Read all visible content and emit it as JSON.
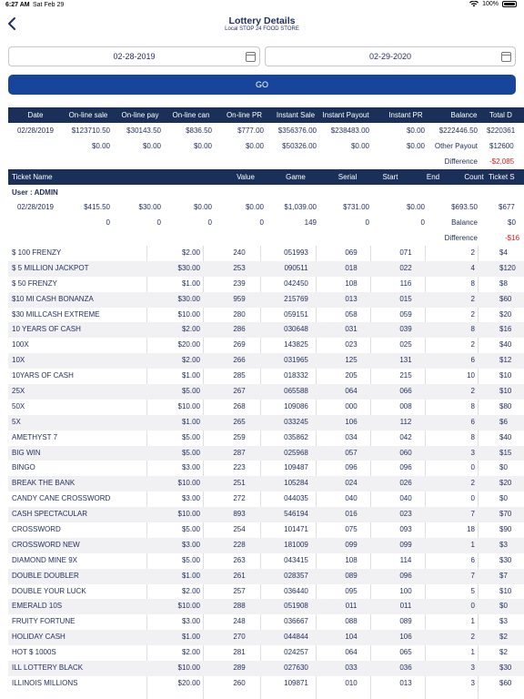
{
  "status": {
    "time": "6:27 AM",
    "date": "Sat Feb 29",
    "battery": "100%"
  },
  "nav": {
    "title": "Lottery Details",
    "subtitle": "Local STOP 24 FOOD STORE"
  },
  "filters": {
    "start_date": "02-28-2019",
    "end_date": "02-29-2020",
    "go_label": "GO"
  },
  "summary": {
    "headers": [
      "Date",
      "On-line sale",
      "On-line pay",
      "On-line can",
      "On-line PR",
      "Instant Sale",
      "Instant Payout",
      "Instant PR",
      "Balance",
      "Total D"
    ],
    "row1": [
      "02/28/2019",
      "$123710.50",
      "$30143.50",
      "$836.50",
      "$777.00",
      "$356376.00",
      "$238483.00",
      "$0.00",
      "$222446.50",
      "$220361"
    ],
    "row2": [
      "$0.00",
      "$0.00",
      "$0.00",
      "$0.00",
      "$50326.00",
      "$0.00",
      "$0.00",
      "Other Payout",
      "$12600"
    ],
    "row3": [
      "Difference",
      "-$2,085"
    ]
  },
  "ticket_section": {
    "headers": [
      "Ticket Name",
      "Value",
      "Game",
      "Serial",
      "Start",
      "End",
      "Count",
      "Ticket S"
    ],
    "user_label": "User : ADMIN",
    "user_row1": [
      "02/28/2019",
      "$415.50",
      "$30.00",
      "$0.00",
      "$0.00",
      "$1,039.00",
      "$731.00",
      "$0.00",
      "$693.50",
      "$677"
    ],
    "user_row2": [
      "0",
      "0",
      "0",
      "0",
      "149",
      "0",
      "0",
      "Balance",
      "$0"
    ],
    "user_row3": [
      "Difference",
      "-$16"
    ]
  },
  "tickets": [
    [
      "$ 100 FRENZY",
      "$2.00",
      "240",
      "051993",
      "069",
      "071",
      "2",
      "$4"
    ],
    [
      "$ 5 MILLION JACKPOT",
      "$30.00",
      "253",
      "090511",
      "018",
      "022",
      "4",
      "$120"
    ],
    [
      "$ 50 FRENZY",
      "$1.00",
      "239",
      "042450",
      "108",
      "116",
      "8",
      "$8"
    ],
    [
      "$10 MI CASH BONANZA",
      "$30.00",
      "959",
      "215769",
      "013",
      "015",
      "2",
      "$60"
    ],
    [
      "$30 MILLCASH EXTREME",
      "$10.00",
      "280",
      "059151",
      "058",
      "059",
      "2",
      "$20"
    ],
    [
      "10 YEARS OF CASH",
      "$2.00",
      "286",
      "030648",
      "031",
      "039",
      "8",
      "$16"
    ],
    [
      "100X",
      "$20.00",
      "269",
      "143825",
      "023",
      "025",
      "2",
      "$40"
    ],
    [
      "10X",
      "$2.00",
      "266",
      "031965",
      "125",
      "131",
      "6",
      "$12"
    ],
    [
      "10YARS OF CASH",
      "$1.00",
      "285",
      "018332",
      "205",
      "215",
      "10",
      "$10"
    ],
    [
      "25X",
      "$5.00",
      "267",
      "065588",
      "064",
      "066",
      "2",
      "$10"
    ],
    [
      "50X",
      "$10.00",
      "268",
      "109086",
      "000",
      "008",
      "8",
      "$80"
    ],
    [
      "5X",
      "$1.00",
      "265",
      "033245",
      "106",
      "112",
      "6",
      "$6"
    ],
    [
      "AMETHYST 7",
      "$5.00",
      "259",
      "035862",
      "034",
      "042",
      "8",
      "$40"
    ],
    [
      "BIG WIN",
      "$5.00",
      "287",
      "025968",
      "057",
      "060",
      "3",
      "$15"
    ],
    [
      "BINGO",
      "$3.00",
      "223",
      "109487",
      "096",
      "096",
      "0",
      "$0"
    ],
    [
      "BREAK THE BANK",
      "$10.00",
      "251",
      "105284",
      "024",
      "026",
      "2",
      "$20"
    ],
    [
      "CANDY CANE CROSSWORD",
      "$3.00",
      "272",
      "044035",
      "040",
      "040",
      "0",
      "$0"
    ],
    [
      "CASH SPECTACULAR",
      "$10.00",
      "893",
      "546194",
      "016",
      "023",
      "7",
      "$70"
    ],
    [
      "CROSSWORD",
      "$5.00",
      "254",
      "101471",
      "075",
      "093",
      "18",
      "$90"
    ],
    [
      "CROSSWORD  NEW",
      "$3.00",
      "228",
      "181009",
      "099",
      "099",
      "1",
      "$3"
    ],
    [
      "DIAMOND MINE 9X",
      "$5.00",
      "263",
      "043415",
      "108",
      "114",
      "6",
      "$30"
    ],
    [
      "DOUBLE DOUBLER",
      "$1.00",
      "261",
      "028357",
      "089",
      "096",
      "7",
      "$7"
    ],
    [
      "DOUBLE YOUR LUCK",
      "$2.00",
      "257",
      "036440",
      "095",
      "100",
      "5",
      "$10"
    ],
    [
      "EMERALD 10S",
      "$10.00",
      "288",
      "051908",
      "011",
      "011",
      "0",
      "$0"
    ],
    [
      "FRUITY FORTUNE",
      "$3.00",
      "248",
      "036667",
      "088",
      "089",
      "1",
      "$3"
    ],
    [
      "HOLIDAY CASH",
      "$1.00",
      "270",
      "044844",
      "104",
      "106",
      "2",
      "$2"
    ],
    [
      "HOT $ 1000S",
      "$2.00",
      "281",
      "024257",
      "064",
      "065",
      "1",
      "$2"
    ],
    [
      "ILL LOTTERY BLACK",
      "$10.00",
      "289",
      "027630",
      "033",
      "036",
      "3",
      "$30"
    ],
    [
      "ILLINOIS MILLIONS",
      "$20.00",
      "260",
      "109871",
      "010",
      "013",
      "3",
      "$60"
    ]
  ]
}
